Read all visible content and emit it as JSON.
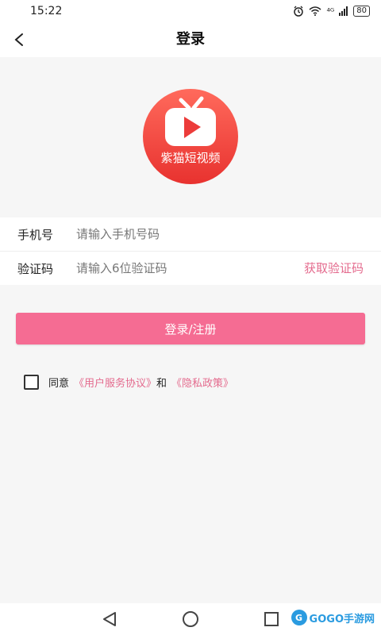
{
  "status_bar": {
    "time": "15:22",
    "signal": "⁴ᴳ",
    "battery": "80"
  },
  "header": {
    "title": "登录"
  },
  "logo": {
    "label": "紫猫短视频",
    "icon": "play-tv-icon",
    "colors": {
      "bg_top": "#ff6a5c",
      "bg_bottom": "#e8322f"
    }
  },
  "form": {
    "phone_label": "手机号",
    "phone_placeholder": "请输入手机号码",
    "phone_value": "",
    "code_label": "验证码",
    "code_placeholder": "请输入6位验证码",
    "code_value": "",
    "get_code_label": "获取验证码"
  },
  "login_button": {
    "label": "登录/注册"
  },
  "agreement": {
    "checked": false,
    "prefix": "同意",
    "user_agreement": "《用户服务协议》",
    "and": "和",
    "privacy": "《隐私政策》"
  },
  "watermark": {
    "text": "GOGO手游网",
    "badge": "G"
  },
  "colors": {
    "accent": "#f56c93",
    "link": "#e46b8e",
    "background": "#f6f6f6"
  }
}
